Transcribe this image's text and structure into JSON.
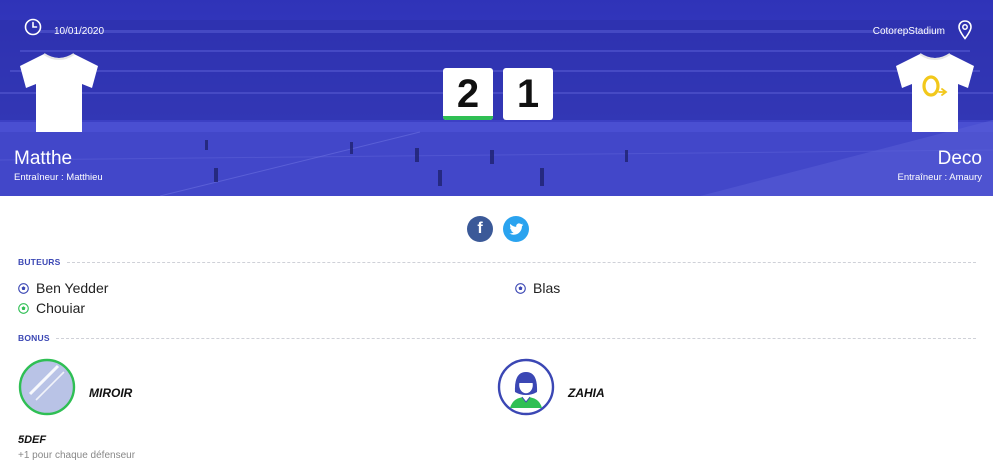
{
  "match": {
    "date": "10/01/2020",
    "stadium": "CotorepStadium",
    "home": {
      "name": "Matthe",
      "coach": "Entraîneur : Matthieu",
      "score": "2",
      "jersey": "white"
    },
    "away": {
      "name": "Deco",
      "coach": "Entraîneur : Amaury",
      "score": "1",
      "jersey": "white-with-yellow-logo"
    },
    "winner": "home"
  },
  "social": {
    "facebook_label": "f",
    "twitter_label": "t"
  },
  "sections": {
    "scorers_title": "BUTEURS",
    "bonus_title": "BONUS"
  },
  "scorers": {
    "home": [
      {
        "name": "Ben Yedder",
        "ball": "blue"
      },
      {
        "name": "Chouiar",
        "ball": "green"
      }
    ],
    "away": [
      {
        "name": "Blas",
        "ball": "blue"
      }
    ]
  },
  "bonus": {
    "home": {
      "name": "MIROIR",
      "icon": "mirror-icon"
    },
    "away": {
      "name": "ZAHIA",
      "icon": "woman-avatar-icon"
    }
  },
  "extra": {
    "title": "5DEF",
    "description": "+1 pour chaque défenseur"
  },
  "colors": {
    "hero": "#3a40c6",
    "accent": "#3b47b4",
    "win": "#2fbf54",
    "facebook": "#3b5998",
    "twitter": "#2aa3ef"
  }
}
